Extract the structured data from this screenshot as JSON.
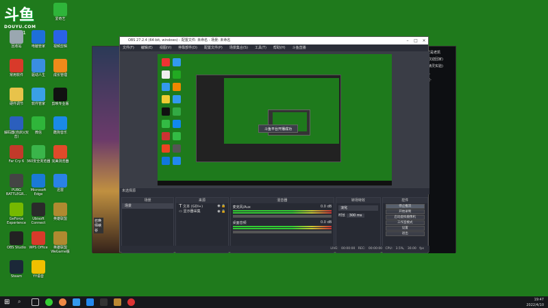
{
  "desktop": {
    "logo": {
      "big": "斗鱼",
      "small": "DOUYU.COM",
      "num": "5701"
    },
    "icons": [
      {
        "label": "爱奇艺",
        "color": "#2fb53a"
      },
      {
        "label": "回收站",
        "color": "#9aa7b0"
      },
      {
        "label": "电脑管家",
        "color": "#1e6fd9"
      },
      {
        "label": "视频剪辑",
        "color": "#2a62e6"
      },
      {
        "label": "常用软件",
        "color": "#d83a2a"
      },
      {
        "label": "驱动人生",
        "color": "#3a8ee0"
      },
      {
        "label": "成长管理",
        "color": "#f08a1a"
      },
      {
        "label": "硬件调节",
        "color": "#e8c34a"
      },
      {
        "label": "软件管家",
        "color": "#3aa0e6"
      },
      {
        "label": "剪映专业版",
        "color": "#111111"
      },
      {
        "label": "解码器(自启)(双击)",
        "color": "#2b5fbd"
      },
      {
        "label": "微信",
        "color": "#2fb53a"
      },
      {
        "label": "酷狗音乐",
        "color": "#1a8ae6"
      },
      {
        "label": "Far Cry 6",
        "color": "#c23a2a"
      },
      {
        "label": "360安全浏览器",
        "color": "#3ab54a"
      },
      {
        "label": "完美浏览器",
        "color": "#e04a2a"
      },
      {
        "label": "PUBG BATTLEGR...",
        "color": "#444444"
      },
      {
        "label": "Microsoft Edge",
        "color": "#1a7ad6"
      },
      {
        "label": "迅雷",
        "color": "#2a82e6"
      },
      {
        "label": "GeForce Experience",
        "color": "#76b900"
      },
      {
        "label": "Ubisoft Connect",
        "color": "#2a2a2a"
      },
      {
        "label": "英雄联盟",
        "color": "#b08a30"
      },
      {
        "label": "OBS Studio",
        "color": "#222222"
      },
      {
        "label": "WPS Office",
        "color": "#d83a2a"
      },
      {
        "label": "英雄联盟WeGame版",
        "color": "#b08a30"
      },
      {
        "label": "Steam",
        "color": "#1b2838"
      },
      {
        "label": "YY语音",
        "color": "#f0c000"
      }
    ]
  },
  "game_window": {
    "side_label": "召唤师峡谷",
    "right_panel": [
      "就是老凯",
      "(欢迎回家)",
      "(精灵实验)",
      "入",
      "流-",
      "·"
    ]
  },
  "obs": {
    "title": "OBS 27.2.4 (64-bit, windows) - 配置文件: 未命名 - 场景: 未命名",
    "menu": [
      "文件(F)",
      "编辑(E)",
      "视图(V)",
      "停靠部件(D)",
      "配置文件(P)",
      "场景集合(S)",
      "工具(T)",
      "帮助(H)",
      "斗鱼直播"
    ],
    "preview_toast": "斗鱼平台开播成功",
    "scene_label": "未选择源",
    "docks": {
      "scenes": {
        "title": "场景",
        "items": [
          "场景"
        ]
      },
      "sources": {
        "title": "来源",
        "items": [
          "文本 (GDI+)",
          "显示器采集"
        ]
      },
      "mixer": {
        "title": "混音器",
        "channels": [
          {
            "name": "麦克风/Aux",
            "level": "0.0 dB"
          },
          {
            "name": "桌面音频",
            "level": "0.0 dB"
          }
        ]
      },
      "transitions": {
        "title": "转场特效",
        "type": "淡化",
        "duration_label": "时长",
        "duration": "300 ms"
      },
      "controls": {
        "title": "控件",
        "buttons": [
          "停止推流",
          "开始录制",
          "启动虚拟摄像机",
          "工作室模式",
          "设置",
          "退出"
        ]
      }
    },
    "dock_actions": {
      "add": "+",
      "remove": "−",
      "up": "∧",
      "down": "∨"
    },
    "status": [
      "LIVE: 00:00:00",
      "REC: 00:00:00",
      "CPU: 3.5%, 30.00 fps"
    ]
  },
  "taskbar": {
    "time": "19:47",
    "date": "2022/4/10"
  }
}
